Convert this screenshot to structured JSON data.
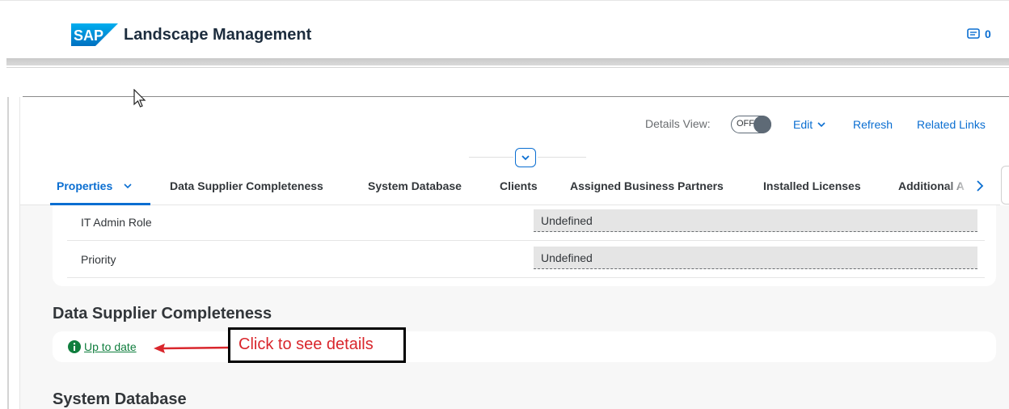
{
  "header": {
    "logo_text": "SAP",
    "app_title": "Landscape Management",
    "notifications_count": "0",
    "notifications_icon": "message-icon"
  },
  "object_header": {
    "details_view_label": "Details View:",
    "details_view_toggle": "OFF",
    "edit_label": "Edit",
    "refresh_label": "Refresh",
    "related_links_label": "Related Links"
  },
  "tabs": [
    {
      "label": "Properties",
      "active": true
    },
    {
      "label": "Data Supplier Completeness"
    },
    {
      "label": "System Database"
    },
    {
      "label": "Clients"
    },
    {
      "label": "Assigned Business Partners"
    },
    {
      "label": "Installed Licenses"
    },
    {
      "label": "Additional A"
    }
  ],
  "properties": [
    {
      "label": "IT Admin Role",
      "value": "Undefined"
    },
    {
      "label": "Priority",
      "value": "Undefined"
    }
  ],
  "data_supplier": {
    "title": "Data Supplier Completeness",
    "status_link": "Up to date",
    "callout": "Click to see details"
  },
  "system_database": {
    "title": "System Database"
  },
  "colors": {
    "accent": "#0a6ed1",
    "success": "#107e3e",
    "callout_text": "#d9262c"
  }
}
